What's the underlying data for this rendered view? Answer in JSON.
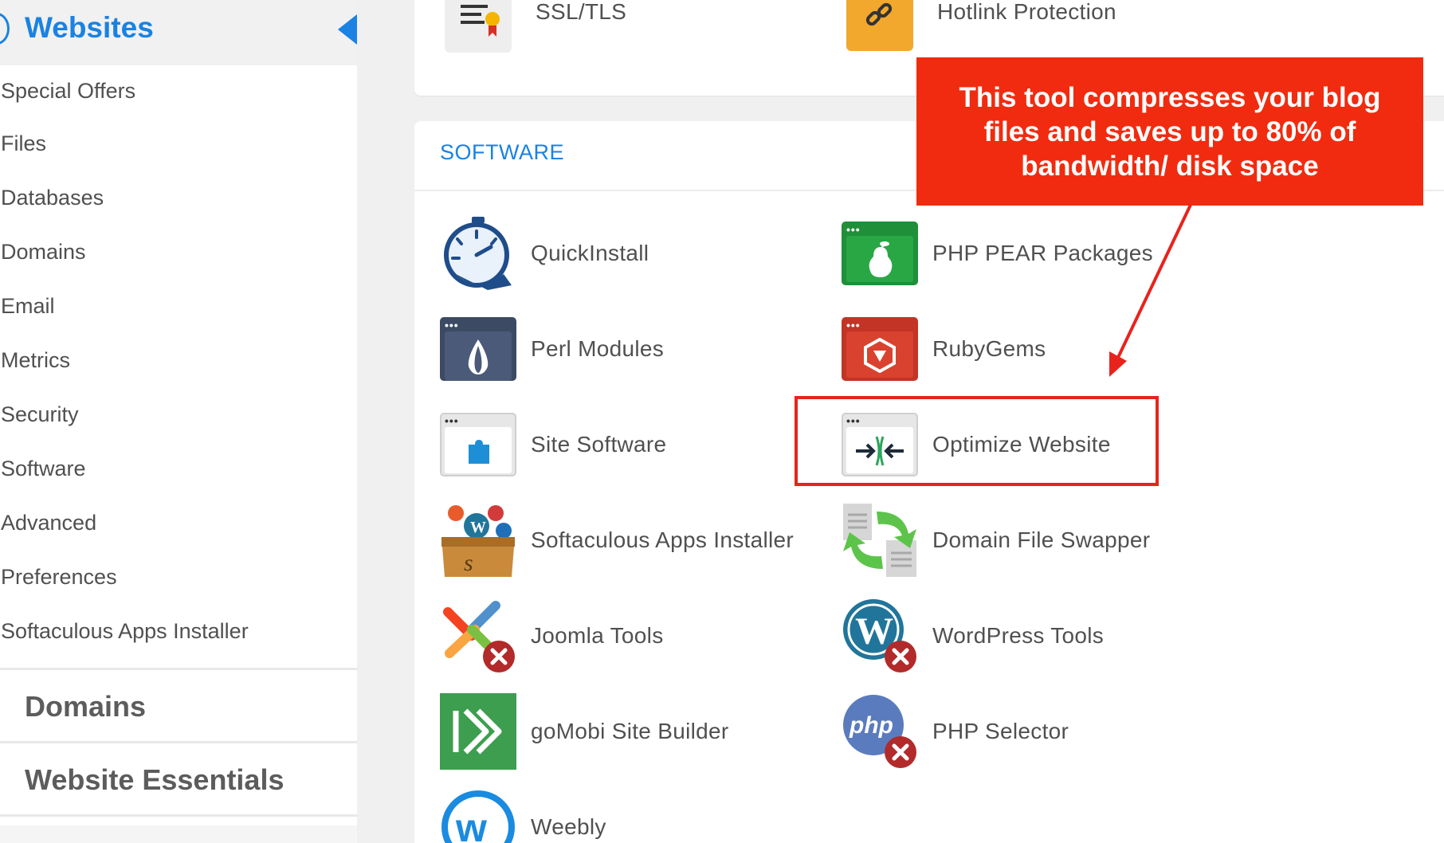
{
  "sidebar": {
    "title": "Websites",
    "items": [
      {
        "label": "Special Offers"
      },
      {
        "label": "Files"
      },
      {
        "label": "Databases"
      },
      {
        "label": "Domains"
      },
      {
        "label": "Email"
      },
      {
        "label": "Metrics"
      },
      {
        "label": "Security"
      },
      {
        "label": "Software"
      },
      {
        "label": "Advanced"
      },
      {
        "label": "Preferences"
      },
      {
        "label": "Softaculous Apps Installer"
      }
    ],
    "sections": [
      {
        "label": "Domains"
      },
      {
        "label": "Website Essentials"
      }
    ]
  },
  "top_card": {
    "tools": [
      {
        "label": "SSL/TLS",
        "icon": "certificate-icon"
      },
      {
        "label": "Hotlink Protection",
        "icon": "link-icon"
      }
    ]
  },
  "software": {
    "header": "SOFTWARE",
    "tools": [
      {
        "label": "QuickInstall",
        "icon": "stopwatch-icon"
      },
      {
        "label": "PHP PEAR Packages",
        "icon": "pear-icon"
      },
      {
        "label": "Perl Modules",
        "icon": "onion-icon"
      },
      {
        "label": "RubyGems",
        "icon": "ruby-gem-icon"
      },
      {
        "label": "Site Software",
        "icon": "puzzle-icon"
      },
      {
        "label": "Optimize Website",
        "icon": "compress-arrows-icon"
      },
      {
        "label": "Softaculous Apps Installer",
        "icon": "toolbox-icon"
      },
      {
        "label": "Domain File Swapper",
        "icon": "file-swap-icon"
      },
      {
        "label": "Joomla Tools",
        "icon": "joomla-icon"
      },
      {
        "label": "WordPress Tools",
        "icon": "wordpress-icon"
      },
      {
        "label": "goMobi Site Builder",
        "icon": "gomobi-icon"
      },
      {
        "label": "PHP Selector",
        "icon": "php-icon"
      },
      {
        "label": "Weebly",
        "icon": "weebly-icon"
      }
    ]
  },
  "annotation": {
    "text": "This tool compresses your blog files and saves up to 80% of bandwidth/ disk space"
  },
  "colors": {
    "accent": "#1a82e2",
    "annotation_red": "#f12b0f",
    "highlight_red": "#e8231c",
    "text_gray": "#505050"
  }
}
